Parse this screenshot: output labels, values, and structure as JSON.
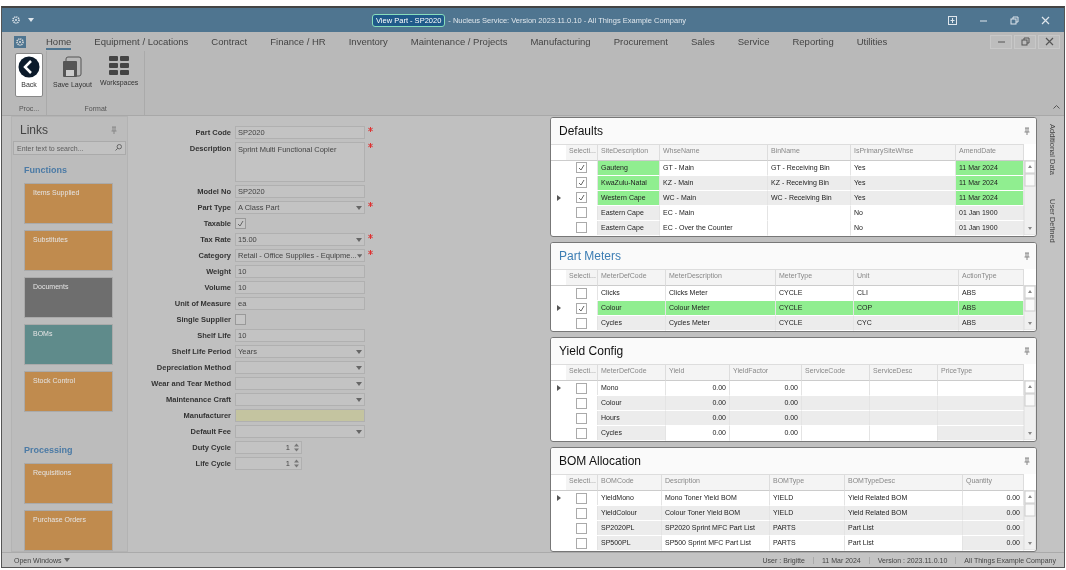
{
  "window": {
    "title": "View Part - SP2020",
    "subtitle": "- Nucleus Service: Version 2023.11.0.10 - All Things Example Company"
  },
  "menu": [
    {
      "label": "Home",
      "selected": true
    },
    {
      "label": "Equipment / Locations",
      "selected": false
    },
    {
      "label": "Contract",
      "selected": false
    },
    {
      "label": "Finance / HR",
      "selected": false
    },
    {
      "label": "Inventory",
      "selected": false
    },
    {
      "label": "Maintenance / Projects",
      "selected": false
    },
    {
      "label": "Manufacturing",
      "selected": false
    },
    {
      "label": "Procurement",
      "selected": false
    },
    {
      "label": "Sales",
      "selected": false
    },
    {
      "label": "Service",
      "selected": false
    },
    {
      "label": "Reporting",
      "selected": false
    },
    {
      "label": "Utilities",
      "selected": false
    }
  ],
  "ribbon": [
    {
      "label": "Proc...",
      "buttons": [
        {
          "kind": "back",
          "label": "Back"
        }
      ]
    },
    {
      "label": "Format",
      "buttons": [
        {
          "kind": "save",
          "label": "Save Layout"
        },
        {
          "kind": "grid",
          "label": "Workspaces"
        }
      ]
    }
  ],
  "links": {
    "title": "Links",
    "search_placeholder": "Enter text to search...",
    "sections": [
      {
        "heading": "Functions",
        "items": [
          {
            "label": "Items Supplied",
            "color": "#c08b4e"
          },
          {
            "label": "Substitutes",
            "color": "#c08b4e"
          },
          {
            "label": "Documents",
            "color": "#6e6e6e"
          },
          {
            "label": "BOMs",
            "color": "#5f8b8b"
          },
          {
            "label": "Stock Control",
            "color": "#c08b4e"
          }
        ]
      },
      {
        "heading": "Processing",
        "items": [
          {
            "label": "Requisitions",
            "color": "#c08b4e"
          },
          {
            "label": "Purchase Orders",
            "color": "#c08b4e"
          }
        ]
      }
    ]
  },
  "form": [
    {
      "label": "Part Code",
      "kind": "text",
      "value": "SP2020",
      "required": true
    },
    {
      "label": "Description",
      "kind": "textarea",
      "value": "Sprint Multi Functional Copier",
      "required": true
    },
    {
      "label": "Model No",
      "kind": "text",
      "value": "SP2020",
      "required": false
    },
    {
      "label": "Part Type",
      "kind": "select",
      "value": "A Class Part",
      "required": true
    },
    {
      "label": "Taxable",
      "kind": "checkbox",
      "checked": true,
      "required": false
    },
    {
      "label": "Tax Rate",
      "kind": "select",
      "value": "15.00",
      "required": true
    },
    {
      "label": "Category",
      "kind": "select",
      "value": "Retail - Office Supplies - Equipme...",
      "required": true
    },
    {
      "label": "Weight",
      "kind": "text",
      "value": "10",
      "required": false
    },
    {
      "label": "Volume",
      "kind": "text",
      "value": "10",
      "required": false
    },
    {
      "label": "Unit of Measure",
      "kind": "text",
      "value": "ea",
      "required": false
    },
    {
      "label": "Single Supplier",
      "kind": "checkbox",
      "checked": false,
      "required": false
    },
    {
      "label": "Shelf Life",
      "kind": "text",
      "value": "10",
      "required": false
    },
    {
      "label": "Shelf Life Period",
      "kind": "select",
      "value": "Years",
      "required": false
    },
    {
      "label": "Depreciation Method",
      "kind": "select",
      "required": false
    },
    {
      "label": "Wear and Tear Method",
      "kind": "select",
      "required": false
    },
    {
      "label": "Maintenance Craft",
      "kind": "select",
      "required": false
    },
    {
      "label": "Manufacturer",
      "kind": "lookup",
      "required": false
    },
    {
      "label": "Default Fee",
      "kind": "select",
      "required": false
    },
    {
      "label": "Duty Cycle",
      "kind": "spin",
      "value": "1",
      "required": false
    },
    {
      "label": "Life Cycle",
      "kind": "spin",
      "value": "1",
      "required": false
    }
  ],
  "panels": [
    {
      "title": "Defaults",
      "check_column": "Selecti...",
      "columns": [
        {
          "label": "SiteDescription",
          "kind": "text"
        },
        {
          "label": "WhseName",
          "kind": "text"
        },
        {
          "label": "BinName",
          "kind": "text"
        },
        {
          "label": "IsPrimarySiteWhse",
          "kind": "text"
        },
        {
          "label": "AmendDate",
          "kind": "text"
        }
      ],
      "rows": [
        {
          "checked": true,
          "current": false,
          "highlighted": [
            true,
            false,
            false,
            false,
            true
          ],
          "cells": [
            "Gauteng",
            "GT - Main",
            "GT - Receiving Bin",
            "Yes",
            "11 Mar 2024"
          ]
        },
        {
          "checked": true,
          "current": false,
          "highlighted": [
            true,
            false,
            false,
            false,
            true
          ],
          "cells": [
            "KwaZulu-Natal",
            "KZ - Main",
            "KZ - Receiving Bin",
            "Yes",
            "11 Mar 2024"
          ]
        },
        {
          "checked": true,
          "current": true,
          "highlighted": [
            true,
            false,
            false,
            false,
            true
          ],
          "cells": [
            "Western Cape",
            "WC - Main",
            "WC - Receiving Bin",
            "Yes",
            "11 Mar 2024"
          ]
        },
        {
          "checked": false,
          "current": false,
          "highlighted": [
            false,
            false,
            false,
            false,
            false
          ],
          "cells": [
            "Eastern Cape",
            "EC - Main",
            "",
            "No",
            "01 Jan 1900"
          ]
        },
        {
          "checked": false,
          "current": false,
          "highlighted": [
            false,
            false,
            false,
            false,
            false
          ],
          "cells": [
            "Eastern Cape",
            "EC - Over the Counter",
            "",
            "No",
            "01 Jan 1900"
          ]
        }
      ]
    },
    {
      "title": "Part Meters",
      "check_column": "Selecti...",
      "columns": [
        {
          "label": "MeterDefCode",
          "kind": "text"
        },
        {
          "label": "MeterDescription",
          "kind": "text"
        },
        {
          "label": "MeterType",
          "kind": "text"
        },
        {
          "label": "Unit",
          "kind": "text"
        },
        {
          "label": "ActionType",
          "kind": "text"
        }
      ],
      "rows": [
        {
          "checked": false,
          "current": false,
          "highlighted": [
            false,
            false,
            false,
            false,
            false
          ],
          "cells": [
            "Clicks",
            "Clicks Meter",
            "CYCLE",
            "CLI",
            "ABS"
          ]
        },
        {
          "checked": true,
          "current": true,
          "highlighted": [
            true,
            true,
            true,
            true,
            true
          ],
          "cells": [
            "Colour",
            "Colour Meter",
            "CYCLE",
            "COP",
            "ABS"
          ]
        },
        {
          "checked": false,
          "current": false,
          "highlighted": [
            false,
            false,
            false,
            false,
            false
          ],
          "cells": [
            "Cycles",
            "Cycles Meter",
            "CYCLE",
            "CYC",
            "ABS"
          ]
        }
      ]
    },
    {
      "title": "Yield Config",
      "check_column": "Selecti...",
      "columns": [
        {
          "label": "MeterDefCode",
          "kind": "text"
        },
        {
          "label": "Yield",
          "kind": "number"
        },
        {
          "label": "YieldFactor",
          "kind": "number"
        },
        {
          "label": "ServiceCode",
          "kind": "text"
        },
        {
          "label": "ServiceDesc",
          "kind": "text"
        },
        {
          "label": "PriceType",
          "kind": "text"
        }
      ],
      "rows": [
        {
          "checked": false,
          "current": true,
          "highlighted": [
            false,
            false,
            false,
            false,
            false,
            false
          ],
          "cells": [
            "Mono",
            "0.00",
            "0.00",
            "",
            "",
            ""
          ]
        },
        {
          "checked": false,
          "current": false,
          "highlighted": [
            false,
            false,
            false,
            false,
            false,
            false
          ],
          "cells": [
            "Colour",
            "0.00",
            "0.00",
            "",
            "",
            ""
          ]
        },
        {
          "checked": false,
          "current": false,
          "highlighted": [
            false,
            false,
            false,
            false,
            false,
            false
          ],
          "cells": [
            "Hours",
            "0.00",
            "0.00",
            "",
            "",
            ""
          ]
        },
        {
          "checked": false,
          "current": false,
          "highlighted": [
            false,
            false,
            false,
            false,
            false,
            false
          ],
          "cells": [
            "Cycles",
            "0.00",
            "0.00",
            "",
            "",
            ""
          ]
        }
      ]
    },
    {
      "title": "BOM Allocation",
      "check_column": "Selecti...",
      "columns": [
        {
          "label": "BOMCode",
          "kind": "text"
        },
        {
          "label": "Description",
          "kind": "text"
        },
        {
          "label": "BOMType",
          "kind": "text"
        },
        {
          "label": "BOMTypeDesc",
          "kind": "text"
        },
        {
          "label": "Quantity",
          "kind": "number"
        }
      ],
      "rows": [
        {
          "checked": false,
          "current": true,
          "highlighted": [
            false,
            false,
            false,
            false,
            false
          ],
          "cells": [
            "YieldMono",
            "Mono Toner Yield BOM",
            "YIELD",
            "Yield Related BOM",
            "0.00"
          ]
        },
        {
          "checked": false,
          "current": false,
          "highlighted": [
            false,
            false,
            false,
            false,
            false
          ],
          "cells": [
            "YieldColour",
            "Colour Toner Yield BOM",
            "YIELD",
            "Yield Related BOM",
            "0.00"
          ]
        },
        {
          "checked": false,
          "current": false,
          "highlighted": [
            false,
            false,
            false,
            false,
            false
          ],
          "cells": [
            "SP2020PL",
            "SP2020 Sprint MFC Part List",
            "PARTS",
            "Part List",
            "0.00"
          ]
        },
        {
          "checked": false,
          "current": false,
          "highlighted": [
            false,
            false,
            false,
            false,
            false
          ],
          "cells": [
            "SP500PL",
            "SP500 Sprint MFC Part List",
            "PARTS",
            "Part List",
            "0.00"
          ]
        }
      ]
    }
  ],
  "side_tabs": [
    "Additional Data",
    "User Defined"
  ],
  "status_bar": {
    "windows": "Open Windows",
    "user": "User : Brigitte",
    "date": "11 Mar 2024",
    "version": "Version : 2023.11.0.10",
    "company": "All Things Example Company"
  }
}
